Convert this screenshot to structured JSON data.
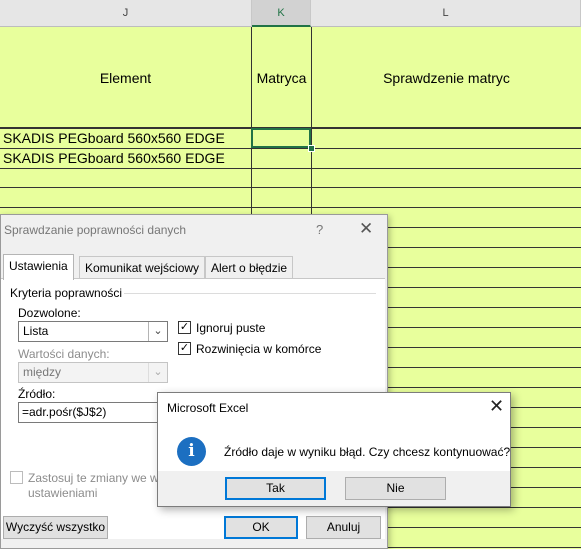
{
  "columns": {
    "j": "J",
    "k": "K",
    "l": "L"
  },
  "sheet": {
    "header_row": {
      "element": "Element",
      "matryca": "Matryca",
      "sprawdzenie": "Sprawdzenie matryc"
    },
    "rows": [
      "SKADIS PEGboard 560x560 EDGE",
      "SKADIS PEGboard 560x560 EDGE"
    ],
    "fill_color": "#e8ff9c",
    "selection_color": "#217346"
  },
  "validation_dialog": {
    "title": "Sprawdzanie poprawności danych",
    "help": "?",
    "close": "✕",
    "tabs": [
      "Ustawienia",
      "Komunikat wejściowy",
      "Alert o błędzie"
    ],
    "criteria_label": "Kryteria poprawności",
    "allow_label": "Dozwolone:",
    "allow_value": "Lista",
    "data_label": "Wartości danych:",
    "data_value": "między",
    "ignore_blank_label": "Ignoruj puste",
    "ignore_blank_checked": true,
    "in_cell_dropdown_label": "Rozwinięcia w komórce",
    "in_cell_dropdown_checked": true,
    "source_label": "Źródło:",
    "source_value": "=adr.pośr($J$2)",
    "apply_line1": "Zastosuj te zmiany we wsz",
    "apply_line2": "ustawieniami",
    "apply_checked": false,
    "clear_button": "Wyczyść wszystko",
    "ok_button": "OK",
    "cancel_button": "Anuluj"
  },
  "message_box": {
    "title": "Microsoft Excel",
    "close": "✕",
    "icon": "info-icon",
    "message": "Źródło daje w wyniku błąd. Czy chcesz kontynuować?",
    "yes_button": "Tak",
    "no_button": "Nie",
    "accent_color": "#0078d7"
  }
}
